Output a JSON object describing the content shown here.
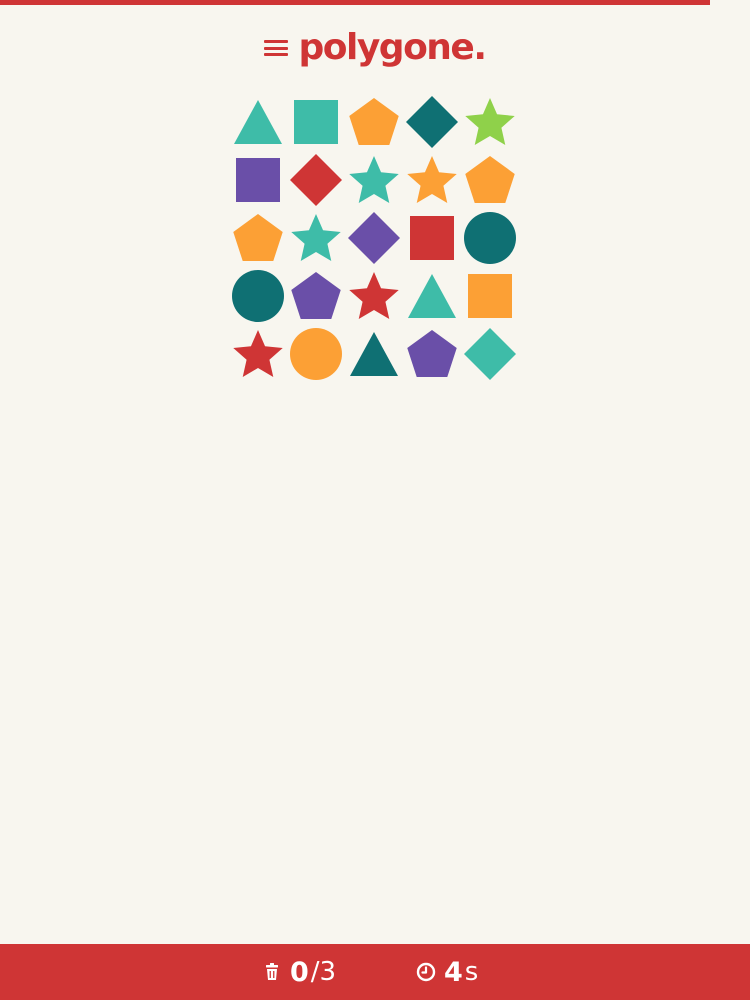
{
  "header": {
    "logo": "polygone.",
    "menu_icon": "hamburger-menu-icon"
  },
  "palette": {
    "red": "#cf3535",
    "teal": "#3ebca8",
    "dark_teal": "#0f7073",
    "orange": "#fca035",
    "purple": "#6a4fa8",
    "green": "#8fd14a",
    "background": "#f8f6ef"
  },
  "board": {
    "rows": 5,
    "cols": 5,
    "cells": [
      {
        "shape": "triangle",
        "color": "teal"
      },
      {
        "shape": "square",
        "color": "teal"
      },
      {
        "shape": "pentagon",
        "color": "orange"
      },
      {
        "shape": "diamond",
        "color": "dark_teal"
      },
      {
        "shape": "star",
        "color": "green"
      },
      {
        "shape": "square",
        "color": "purple"
      },
      {
        "shape": "diamond",
        "color": "red"
      },
      {
        "shape": "star",
        "color": "teal"
      },
      {
        "shape": "star",
        "color": "orange"
      },
      {
        "shape": "pentagon",
        "color": "orange"
      },
      {
        "shape": "pentagon",
        "color": "orange"
      },
      {
        "shape": "star",
        "color": "teal"
      },
      {
        "shape": "diamond",
        "color": "purple"
      },
      {
        "shape": "square",
        "color": "red"
      },
      {
        "shape": "circle",
        "color": "dark_teal"
      },
      {
        "shape": "circle",
        "color": "dark_teal"
      },
      {
        "shape": "pentagon",
        "color": "purple"
      },
      {
        "shape": "star",
        "color": "red"
      },
      {
        "shape": "triangle",
        "color": "teal"
      },
      {
        "shape": "square",
        "color": "orange"
      },
      {
        "shape": "star",
        "color": "red"
      },
      {
        "shape": "circle",
        "color": "orange"
      },
      {
        "shape": "triangle",
        "color": "dark_teal"
      },
      {
        "shape": "pentagon",
        "color": "purple"
      },
      {
        "shape": "diamond",
        "color": "teal"
      }
    ]
  },
  "footer": {
    "moves": {
      "icon": "trash-icon",
      "value": "0",
      "suffix": "/3"
    },
    "timer": {
      "icon": "clock-icon",
      "value": "4",
      "suffix": "s"
    }
  }
}
